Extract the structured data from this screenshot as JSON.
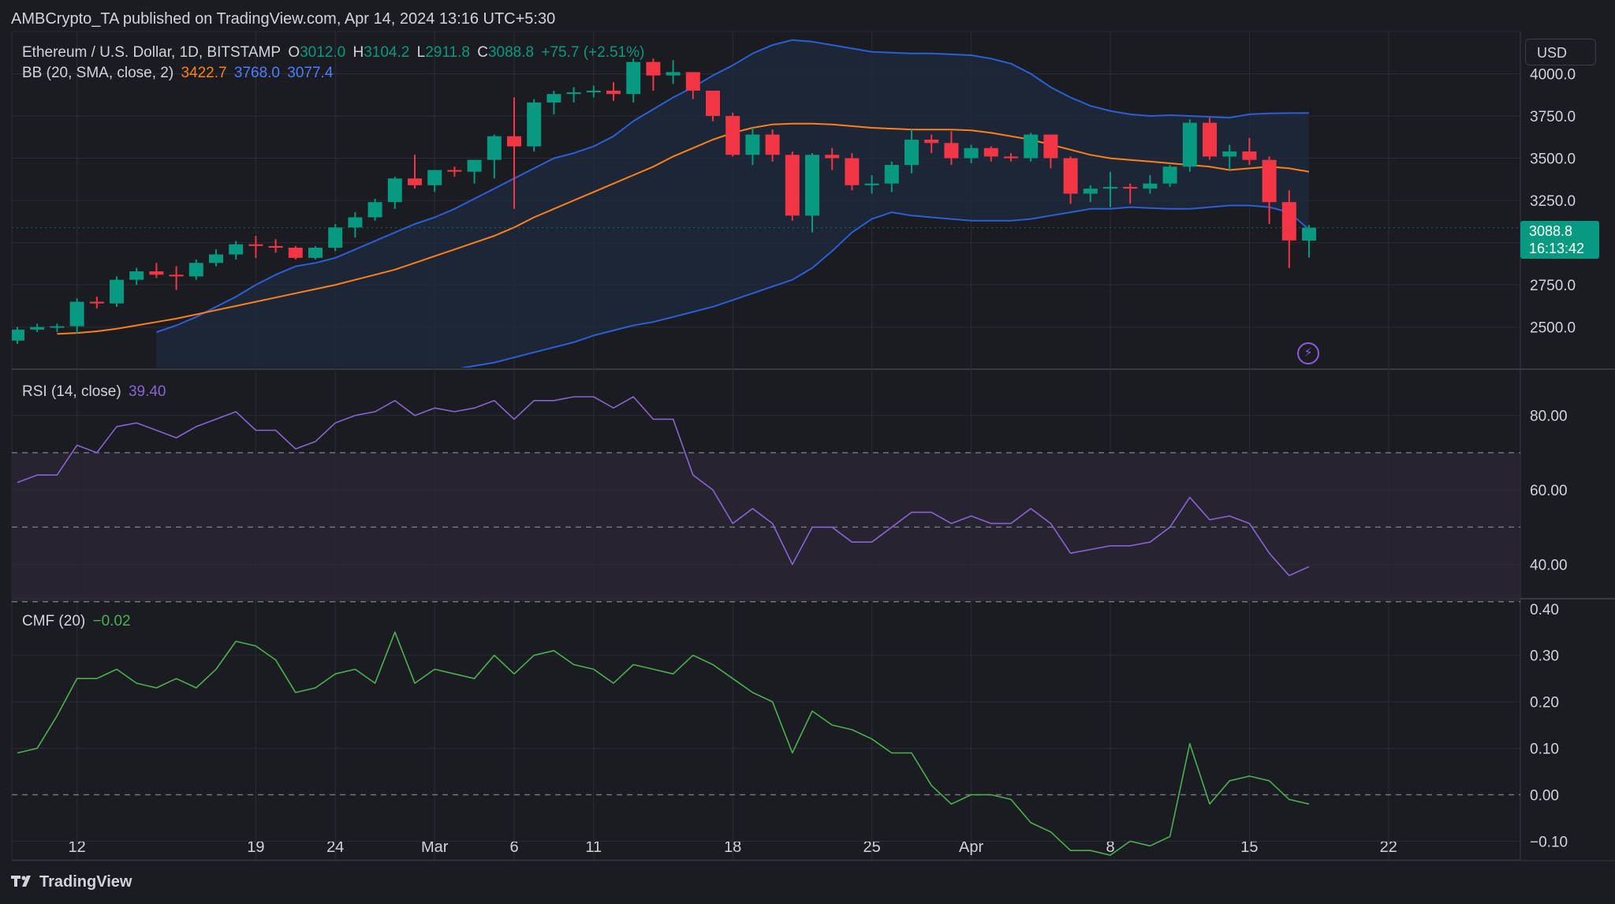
{
  "header": {
    "published_by": "AMBCrypto_TA published on TradingView.com, Apr 14, 2024 13:16 UTC+5:30"
  },
  "legend_main": {
    "symbol": "Ethereum / U.S. Dollar, 1D, BITSTAMP",
    "o_label": "O",
    "o_value": "3012.0",
    "h_label": "H",
    "h_value": "3104.2",
    "l_label": "L",
    "l_value": "2911.8",
    "c_label": "C",
    "c_value": "3088.8",
    "change": "+75.7 (+2.51%)"
  },
  "legend_bb": {
    "label": "BB (20, SMA, close, 2)",
    "basis": "3422.7",
    "upper": "3768.0",
    "lower": "3077.4"
  },
  "legend_rsi": {
    "label": "RSI (14, close)",
    "value": "39.40"
  },
  "legend_cmf": {
    "label": "CMF (20)",
    "value": "−0.02"
  },
  "currency": "USD",
  "last_price": {
    "price": "3088.8",
    "countdown": "16:13:42"
  },
  "branding": {
    "name": "TradingView"
  },
  "icons": {
    "flash": "lightning-icon",
    "logo": "tradingview-logo-icon"
  },
  "colors": {
    "background": "#1b1c21",
    "up": "#089981",
    "down": "#f23645",
    "bb_basis": "#ff7f1a",
    "bb_band": "#2a5fd6",
    "bb_fill": "#1f2a3f",
    "rsi": "#8a63d2",
    "rsi_band": "#2a2536",
    "cmf": "#4caf50",
    "grid": "#2a2d35",
    "text": "#d1d4dc",
    "last_tag": "#089981"
  },
  "chart_data": [
    {
      "type": "candlestick",
      "title": "Ethereum / U.S. Dollar, 1D, BITSTAMP",
      "x_axis_ticks": [
        "12",
        "19",
        "24",
        "Mar",
        "6",
        "11",
        "18",
        "25",
        "Apr",
        "8",
        "15",
        "22"
      ],
      "y_axis_ticks": [
        "4000.0",
        "3750.0",
        "3500.0",
        "3250.0",
        "2750.0",
        "2500.0"
      ],
      "ylim": [
        2260,
        4250
      ],
      "candles": [
        [
          2420,
          2500,
          2400,
          2485
        ],
        [
          2485,
          2520,
          2470,
          2500
        ],
        [
          2500,
          2520,
          2470,
          2505
        ],
        [
          2505,
          2670,
          2460,
          2650
        ],
        [
          2650,
          2680,
          2610,
          2640
        ],
        [
          2640,
          2800,
          2620,
          2780
        ],
        [
          2780,
          2850,
          2750,
          2830
        ],
        [
          2830,
          2880,
          2790,
          2810
        ],
        [
          2810,
          2860,
          2720,
          2800
        ],
        [
          2800,
          2900,
          2780,
          2880
        ],
        [
          2880,
          2960,
          2860,
          2930
        ],
        [
          2930,
          3010,
          2900,
          2990
        ],
        [
          2990,
          3040,
          2910,
          2980
        ],
        [
          2980,
          3020,
          2940,
          2970
        ],
        [
          2970,
          2980,
          2900,
          2910
        ],
        [
          2910,
          2980,
          2900,
          2970
        ],
        [
          2970,
          3110,
          2950,
          3090
        ],
        [
          3090,
          3180,
          3030,
          3150
        ],
        [
          3150,
          3260,
          3130,
          3240
        ],
        [
          3240,
          3390,
          3200,
          3380
        ],
        [
          3380,
          3520,
          3320,
          3340
        ],
        [
          3340,
          3430,
          3300,
          3430
        ],
        [
          3430,
          3450,
          3390,
          3420
        ],
        [
          3420,
          3490,
          3350,
          3490
        ],
        [
          3490,
          3640,
          3380,
          3630
        ],
        [
          3630,
          3860,
          3200,
          3570
        ],
        [
          3570,
          3850,
          3540,
          3830
        ],
        [
          3830,
          3900,
          3760,
          3880
        ],
        [
          3880,
          3920,
          3830,
          3890
        ],
        [
          3890,
          3930,
          3860,
          3900
        ],
        [
          3900,
          3950,
          3840,
          3880
        ],
        [
          3880,
          4090,
          3830,
          4070
        ],
        [
          4070,
          4090,
          3900,
          3990
        ],
        [
          3990,
          4080,
          3940,
          4010
        ],
        [
          4010,
          4000,
          3850,
          3900
        ],
        [
          3900,
          3880,
          3720,
          3750
        ],
        [
          3750,
          3770,
          3510,
          3520
        ],
        [
          3520,
          3680,
          3460,
          3640
        ],
        [
          3640,
          3670,
          3480,
          3520
        ],
        [
          3520,
          3540,
          3130,
          3160
        ],
        [
          3160,
          3530,
          3060,
          3520
        ],
        [
          3520,
          3560,
          3430,
          3500
        ],
        [
          3500,
          3530,
          3310,
          3340
        ],
        [
          3340,
          3400,
          3290,
          3350
        ],
        [
          3350,
          3480,
          3300,
          3460
        ],
        [
          3460,
          3670,
          3410,
          3610
        ],
        [
          3610,
          3640,
          3530,
          3590
        ],
        [
          3590,
          3660,
          3460,
          3500
        ],
        [
          3500,
          3580,
          3470,
          3560
        ],
        [
          3560,
          3570,
          3480,
          3510
        ],
        [
          3510,
          3530,
          3480,
          3500
        ],
        [
          3500,
          3650,
          3480,
          3640
        ],
        [
          3640,
          3640,
          3440,
          3500
        ],
        [
          3500,
          3510,
          3230,
          3290
        ],
        [
          3290,
          3340,
          3240,
          3320
        ],
        [
          3320,
          3420,
          3210,
          3330
        ],
        [
          3330,
          3350,
          3230,
          3320
        ],
        [
          3320,
          3400,
          3290,
          3350
        ],
        [
          3350,
          3460,
          3330,
          3450
        ],
        [
          3450,
          3730,
          3420,
          3710
        ],
        [
          3710,
          3740,
          3490,
          3510
        ],
        [
          3510,
          3580,
          3430,
          3540
        ],
        [
          3540,
          3620,
          3460,
          3490
        ],
        [
          3490,
          3510,
          3110,
          3240
        ],
        [
          3240,
          3310,
          2850,
          3013
        ],
        [
          3012,
          3104.2,
          2911.8,
          3088.8
        ]
      ],
      "bollinger": {
        "basis": [
          2460,
          2465,
          2475,
          2490,
          2510,
          2530,
          2550,
          2575,
          2600,
          2625,
          2650,
          2675,
          2700,
          2725,
          2750,
          2780,
          2810,
          2840,
          2880,
          2920,
          2960,
          3000,
          3040,
          3090,
          3150,
          3200,
          3250,
          3300,
          3350,
          3400,
          3450,
          3510,
          3560,
          3610,
          3650,
          3680,
          3700,
          3705,
          3705,
          3700,
          3690,
          3680,
          3675,
          3670,
          3670,
          3670,
          3665,
          3650,
          3630,
          3610,
          3580,
          3550,
          3520,
          3500,
          3490,
          3480,
          3470,
          3460,
          3450,
          3430,
          3440,
          3450,
          3440,
          3420
        ],
        "upper": [
          2470,
          2510,
          2560,
          2620,
          2680,
          2750,
          2810,
          2860,
          2880,
          2910,
          2960,
          3010,
          3060,
          3110,
          3150,
          3200,
          3260,
          3320,
          3380,
          3440,
          3500,
          3530,
          3570,
          3630,
          3720,
          3790,
          3860,
          3920,
          3990,
          4050,
          4120,
          4170,
          4200,
          4190,
          4170,
          4150,
          4130,
          4125,
          4120,
          4120,
          4115,
          4110,
          4090,
          4060,
          4000,
          3920,
          3860,
          3810,
          3780,
          3760,
          3750,
          3755,
          3750,
          3745,
          3740,
          3760,
          3765,
          3767,
          3768
        ],
        "lower": [
          2250,
          2270,
          2290,
          2320,
          2350,
          2380,
          2410,
          2450,
          2480,
          2510,
          2530,
          2560,
          2590,
          2620,
          2660,
          2700,
          2740,
          2780,
          2850,
          2950,
          3060,
          3140,
          3180,
          3160,
          3150,
          3140,
          3130,
          3130,
          3130,
          3140,
          3160,
          3180,
          3200,
          3200,
          3210,
          3205,
          3200,
          3200,
          3210,
          3220,
          3220,
          3210,
          3180,
          3077.4
        ]
      }
    },
    {
      "type": "line",
      "title": "RSI (14, close)",
      "y_axis_ticks": [
        "80.00",
        "60.00",
        "40.00"
      ],
      "ylim": [
        31,
        92
      ],
      "bands": [
        30,
        50,
        70
      ],
      "values": [
        62,
        64,
        64,
        72,
        70,
        77,
        78,
        76,
        74,
        77,
        79,
        81,
        76,
        76,
        71,
        73,
        78,
        80,
        81,
        84,
        80,
        82,
        81,
        82,
        84,
        79,
        84,
        84,
        85,
        85,
        82,
        85,
        79,
        79,
        64,
        60,
        51,
        55,
        51,
        40,
        50,
        50,
        46,
        46,
        50,
        54,
        54,
        51,
        53,
        51,
        51,
        55,
        51,
        43,
        44,
        45,
        45,
        46,
        50,
        58,
        52,
        53,
        51,
        43,
        37,
        39.4
      ]
    },
    {
      "type": "line",
      "title": "CMF (20)",
      "y_axis_ticks": [
        "0.40",
        "0.30",
        "0.20",
        "0.10",
        "0.00",
        "−0.10"
      ],
      "ylim": [
        -0.14,
        0.42
      ],
      "values": [
        0.09,
        0.1,
        0.17,
        0.25,
        0.25,
        0.27,
        0.24,
        0.23,
        0.25,
        0.23,
        0.27,
        0.33,
        0.32,
        0.29,
        0.22,
        0.23,
        0.26,
        0.27,
        0.24,
        0.35,
        0.24,
        0.27,
        0.26,
        0.25,
        0.3,
        0.26,
        0.3,
        0.31,
        0.28,
        0.27,
        0.24,
        0.28,
        0.27,
        0.26,
        0.3,
        0.28,
        0.25,
        0.22,
        0.2,
        0.09,
        0.18,
        0.15,
        0.14,
        0.12,
        0.09,
        0.09,
        0.02,
        -0.02,
        0.0,
        0.0,
        -0.01,
        -0.06,
        -0.08,
        -0.12,
        -0.12,
        -0.13,
        -0.1,
        -0.11,
        -0.09,
        0.11,
        -0.02,
        0.03,
        0.04,
        0.03,
        -0.01,
        -0.02
      ]
    }
  ]
}
